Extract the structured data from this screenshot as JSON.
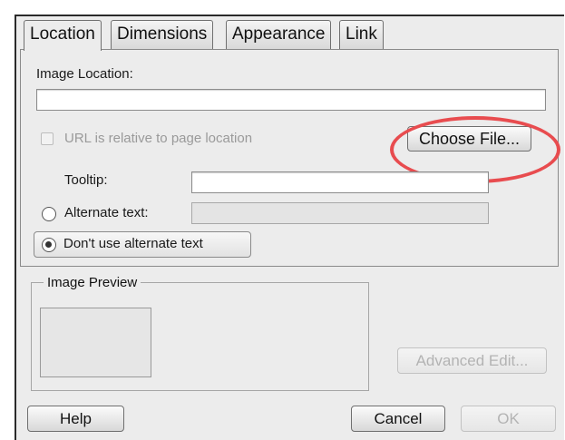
{
  "tabs": [
    {
      "label": "Location",
      "active": true
    },
    {
      "label": "Dimensions",
      "active": false
    },
    {
      "label": "Appearance",
      "active": false
    },
    {
      "label": "Link",
      "active": false
    }
  ],
  "location": {
    "image_location_label": "Image Location:",
    "image_location_value": "",
    "url_relative_label": "URL is relative to page location",
    "url_relative_checked": false,
    "choose_file_label": "Choose File...",
    "tooltip_label": "Tooltip:",
    "tooltip_value": "",
    "alternate_text_label": "Alternate text:",
    "alternate_text_value": "",
    "no_alt_text_label": "Don't use alternate text",
    "no_alt_text_selected": true
  },
  "preview": {
    "group_title": "Image Preview",
    "advanced_edit_label": "Advanced Edit..."
  },
  "footer": {
    "help_label": "Help",
    "cancel_label": "Cancel",
    "ok_label": "OK"
  },
  "colors": {
    "highlight": "#e84c4f",
    "dialog_bg": "#ececec"
  }
}
